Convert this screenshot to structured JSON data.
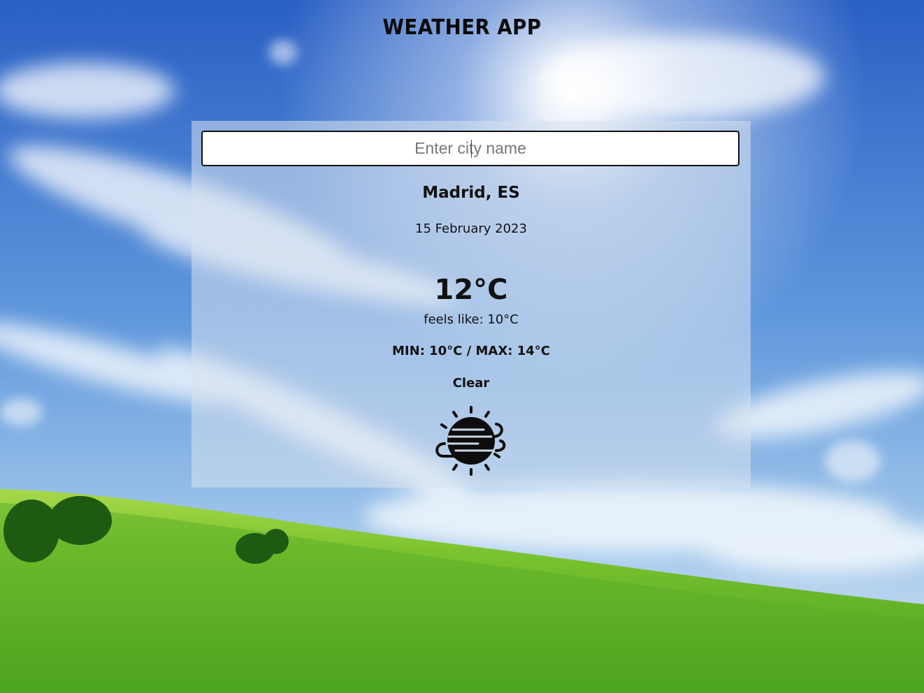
{
  "app": {
    "title": "WEATHER APP"
  },
  "search": {
    "placeholder": "Enter city name",
    "value": ""
  },
  "weather": {
    "location": "Madrid, ES",
    "date": "15 February 2023",
    "temperature": "12°C",
    "feels_like": "feels like: 10°C",
    "min_max": "MIN: 10°C / MAX: 14°C",
    "condition": "Clear",
    "icon": "sun-haze-icon"
  },
  "colors": {
    "sky_top": "#2e63c8",
    "sky_mid": "#6fa3df",
    "grass": "#6cbf2a",
    "card_overlay": "#d7e1ee",
    "text": "#111111"
  }
}
